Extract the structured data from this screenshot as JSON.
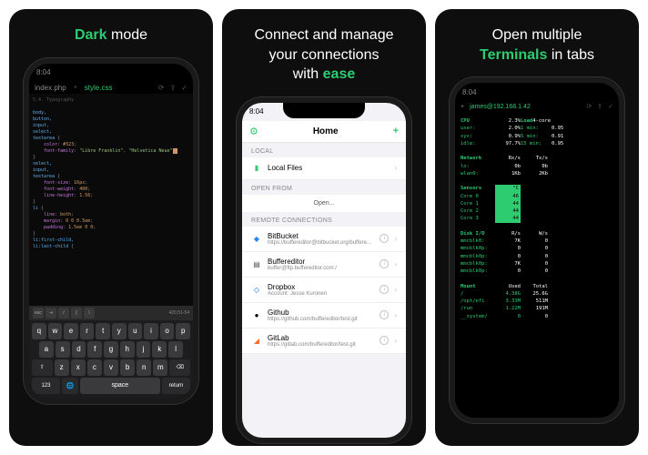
{
  "panels": [
    {
      "title_prefix": "",
      "title_accent": "Dark",
      "title_suffix": " mode"
    },
    {
      "title_lines": [
        "Connect and manage",
        "your connections",
        "with "
      ],
      "title_accent": "ease"
    },
    {
      "title_prefix": "Open multiple\n",
      "title_accent": "Terminals",
      "title_suffix": " in tabs"
    }
  ],
  "phone1": {
    "time": "8:04",
    "tabs": [
      "index.php",
      "style.css"
    ],
    "active_tab_index": 1,
    "code_section": "5.4. Typography",
    "code_elements": "body,\nbutton,\ninput,\nselect,\ntextarea",
    "code_color": "color: #323;",
    "code_font_family": "font-family: \"Libre Franklin\", \"Helvetica Neue\"",
    "code_block2": "select,\ninput,\ntextarea",
    "code_font_size": "font-size: 16px;",
    "code_font_weight": "font-weight: 400;",
    "code_line_height": "line-height: 1.56;",
    "code_sel_li": "li",
    "code_li_line": "line: both;",
    "code_li_margin": "margin: 0 0 0.5em;",
    "code_li_padding": "padding: 1.5em 0 0;",
    "code_first_child": "li:first-child,",
    "code_last_child": "li:last-child",
    "toolbar_keys": [
      "esc",
      "⇥",
      "/",
      "{",
      "\\"
    ],
    "cursor_pos": "420,51-54",
    "keyboard": {
      "row1": [
        "q",
        "w",
        "e",
        "r",
        "t",
        "y",
        "u",
        "i",
        "o",
        "p"
      ],
      "row2": [
        "a",
        "s",
        "d",
        "f",
        "g",
        "h",
        "j",
        "k",
        "l"
      ],
      "row3_shift": "⇧",
      "row3": [
        "z",
        "x",
        "c",
        "v",
        "b",
        "n",
        "m"
      ],
      "row3_del": "⌫",
      "row4": {
        "num": "123",
        "globe": "🌐",
        "space": "space",
        "return": "return"
      }
    }
  },
  "phone2": {
    "time": "8:04",
    "header_title": "Home",
    "section_local": "LOCAL",
    "local_item": "Local Files",
    "section_open": "OPEN FROM",
    "open_label": "Open...",
    "section_remote": "REMOTE CONNECTIONS",
    "connections": [
      {
        "name": "BitBucket",
        "sub": "https://buffereditor@bitbucket.org/buffere...",
        "icon_color": "#2684ff",
        "glyph": "◆"
      },
      {
        "name": "Buffereditor",
        "sub": "buffer@ftp.buffereditor.com:/",
        "icon_color": "#555",
        "glyph": "▤"
      },
      {
        "name": "Dropbox",
        "sub": "Account: Jesse Kuronen",
        "icon_color": "#0061ff",
        "glyph": "◇"
      },
      {
        "name": "Github",
        "sub": "https://github.com/buffereditor/test.git",
        "icon_color": "#000",
        "glyph": "●"
      },
      {
        "name": "GitLab",
        "sub": "https://gitlab.com/buffereditor/test.git",
        "icon_color": "#fc6d26",
        "glyph": "◢"
      }
    ]
  },
  "phone3": {
    "time": "8:04",
    "tab_name": "james@192.168.1.42",
    "cpu": {
      "label": "CPU",
      "val": "2.3%",
      "load_label": "Load",
      "load_val": "4-core"
    },
    "cpu_rows": [
      {
        "l": "user:",
        "v1": "2.0%",
        "l2": "1 min:",
        "v2": "0.95"
      },
      {
        "l": "sys:",
        "v1": "0.9%",
        "l2": "5 min:",
        "v2": "0.91"
      },
      {
        "l": "idle:",
        "v1": "97.7%",
        "l2": "15 min:",
        "v2": "0.95"
      }
    ],
    "net": {
      "label": "Network",
      "rx": "Rx/s",
      "tx": "Tx/s"
    },
    "net_rows": [
      {
        "l": "lo:",
        "v1": "0b",
        "v2": "0b"
      },
      {
        "l": "wlan0:",
        "v1": "1Kb",
        "v2": "2Kb"
      }
    ],
    "sensors": {
      "label": "Sensors",
      "unit": "°C"
    },
    "sensor_rows": [
      {
        "l": "Core 0",
        "v": "46"
      },
      {
        "l": "Core 1",
        "v": "44"
      },
      {
        "l": "Core 2",
        "v": "44"
      },
      {
        "l": "Core 3",
        "v": "44"
      }
    ],
    "disk": {
      "label": "Disk I/O",
      "r": "R/s",
      "w": "W/s"
    },
    "disk_rows": [
      {
        "l": "mmcblk0:",
        "v1": "7K",
        "v2": "0"
      },
      {
        "l": "mmcblk0p:",
        "v1": "0",
        "v2": "0"
      },
      {
        "l": "mmcblk0p:",
        "v1": "0",
        "v2": "0"
      },
      {
        "l": "mmcblk0p:",
        "v1": "7K",
        "v2": "0"
      },
      {
        "l": "mmcblk0p:",
        "v1": "0",
        "v2": "0"
      }
    ],
    "mount": {
      "label": "Mount",
      "used": "Used",
      "total": "Total"
    },
    "mount_rows": [
      {
        "l": "/",
        "v1": "4.38G",
        "v2": "25.6G"
      },
      {
        "l": "/opt/efi",
        "v1": "3.33M",
        "v2": "511M"
      },
      {
        "l": "/run",
        "v1": "1.22M",
        "v2": "191M"
      },
      {
        "l": "__system/",
        "v1": "0",
        "v2": "0"
      }
    ]
  }
}
